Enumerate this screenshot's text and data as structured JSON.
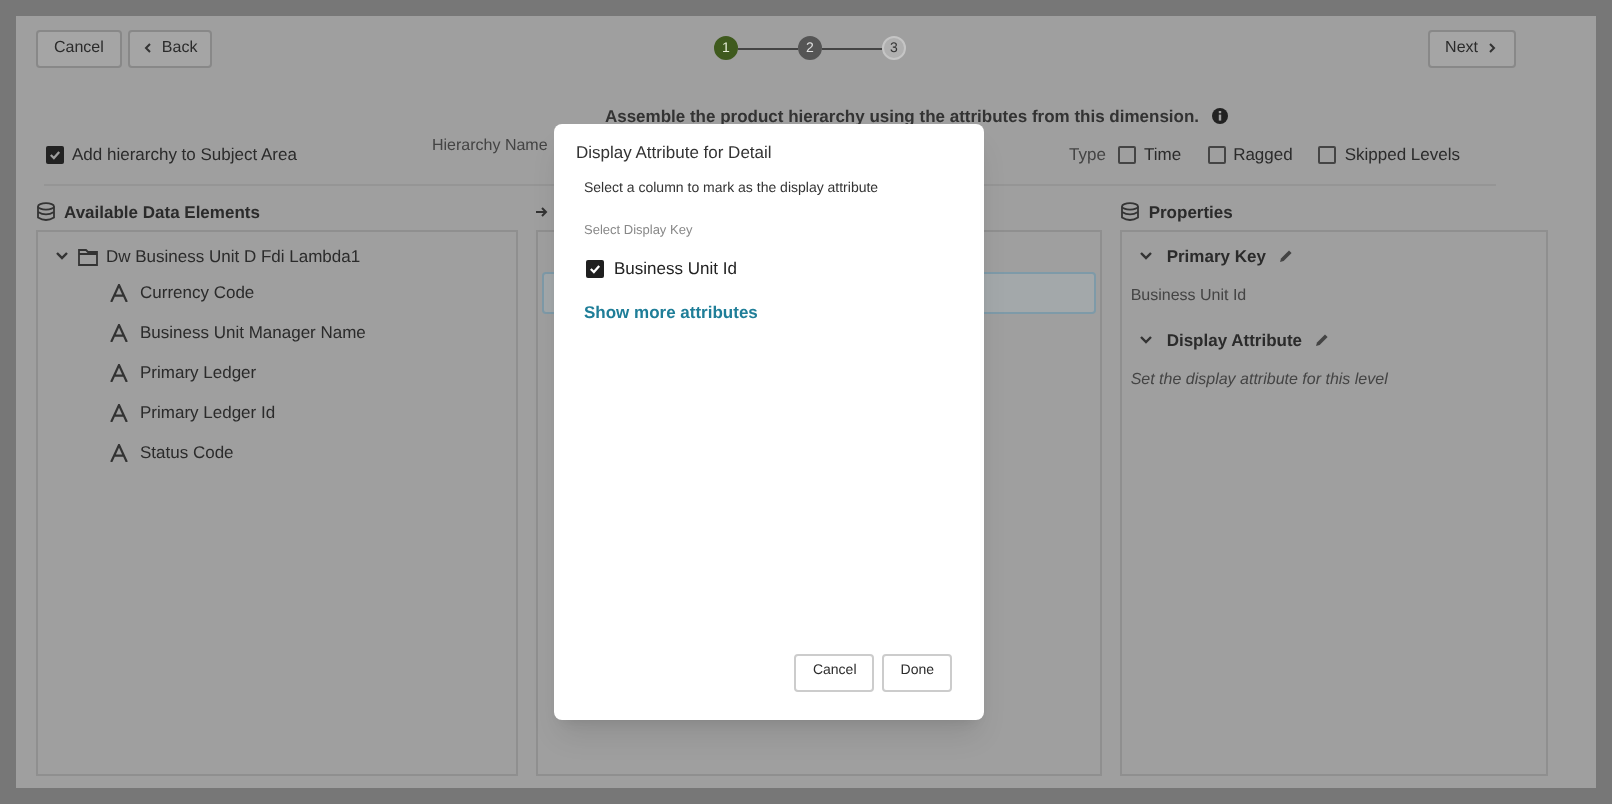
{
  "toolbar": {
    "cancel": "Cancel",
    "back": "Back",
    "next": "Next"
  },
  "steps": [
    {
      "label": "1",
      "completed": true,
      "selected": false
    },
    {
      "label": "2",
      "completed": false,
      "selected": true
    },
    {
      "label": "3",
      "completed": false,
      "selected": false
    }
  ],
  "instruction": "Assemble the product hierarchy using the attributes from this dimension.",
  "options": {
    "add_to_subject_area": {
      "label": "Add hierarchy to Subject Area",
      "checked": true
    },
    "hierarchy_name_label": "Hierarchy Name",
    "type_label": "Type",
    "types": [
      {
        "label": "Time",
        "checked": false
      },
      {
        "label": "Ragged",
        "checked": false
      },
      {
        "label": "Skipped Levels",
        "checked": false
      }
    ]
  },
  "available": {
    "title": "Available Data Elements",
    "root": {
      "label": "Dw Business Unit D Fdi Lambda1",
      "expanded": true,
      "children": [
        {
          "label": "Currency Code"
        },
        {
          "label": "Business Unit Manager Name"
        },
        {
          "label": "Primary Ledger"
        },
        {
          "label": "Primary Ledger Id"
        },
        {
          "label": "Status Code"
        }
      ]
    }
  },
  "properties": {
    "title": "Properties",
    "sections": [
      {
        "title": "Primary Key",
        "expanded": true,
        "value": "Business Unit Id",
        "kind": "value"
      },
      {
        "title": "Display Attribute",
        "expanded": true,
        "value": "Set the display attribute for this level",
        "kind": "hint"
      }
    ]
  },
  "dialog": {
    "title": "Display Attribute for Detail",
    "subtitle": "Select a column to mark as the display attribute",
    "key_label": "Select Display Key",
    "attributes": [
      {
        "label": "Business Unit Id",
        "checked": true
      }
    ],
    "more_link": "Show more attributes",
    "buttons": [
      "Cancel",
      "Done"
    ]
  }
}
